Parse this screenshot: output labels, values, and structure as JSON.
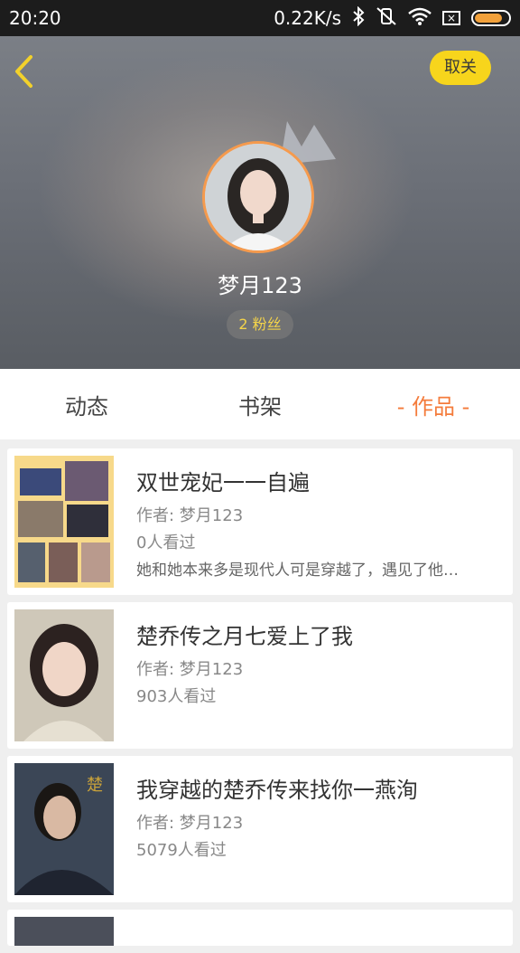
{
  "status_bar": {
    "time": "20:20",
    "network_speed": "0.22K/s"
  },
  "header": {
    "back_icon": "chevron-left-icon",
    "follow_label": "取关",
    "username": "梦月123",
    "fans": "2 粉丝",
    "accent_color": "#f59a4d",
    "button_color": "#f7d51c"
  },
  "tabs": [
    {
      "label": "动态"
    },
    {
      "label": "书架"
    },
    {
      "label": "- 作品 -"
    }
  ],
  "works": [
    {
      "title": "双世宠妃一一自遍",
      "author": "作者: 梦月123",
      "views": "0人看过",
      "desc": "她和她本来多是现代人可是穿越了，遇见了他…"
    },
    {
      "title": "楚乔传之月七爱上了我",
      "author": "作者: 梦月123",
      "views": "903人看过",
      "desc": ""
    },
    {
      "title": "我穿越的楚乔传来找你一燕洵",
      "author": "作者: 梦月123",
      "views": "5079人看过",
      "desc": ""
    }
  ]
}
